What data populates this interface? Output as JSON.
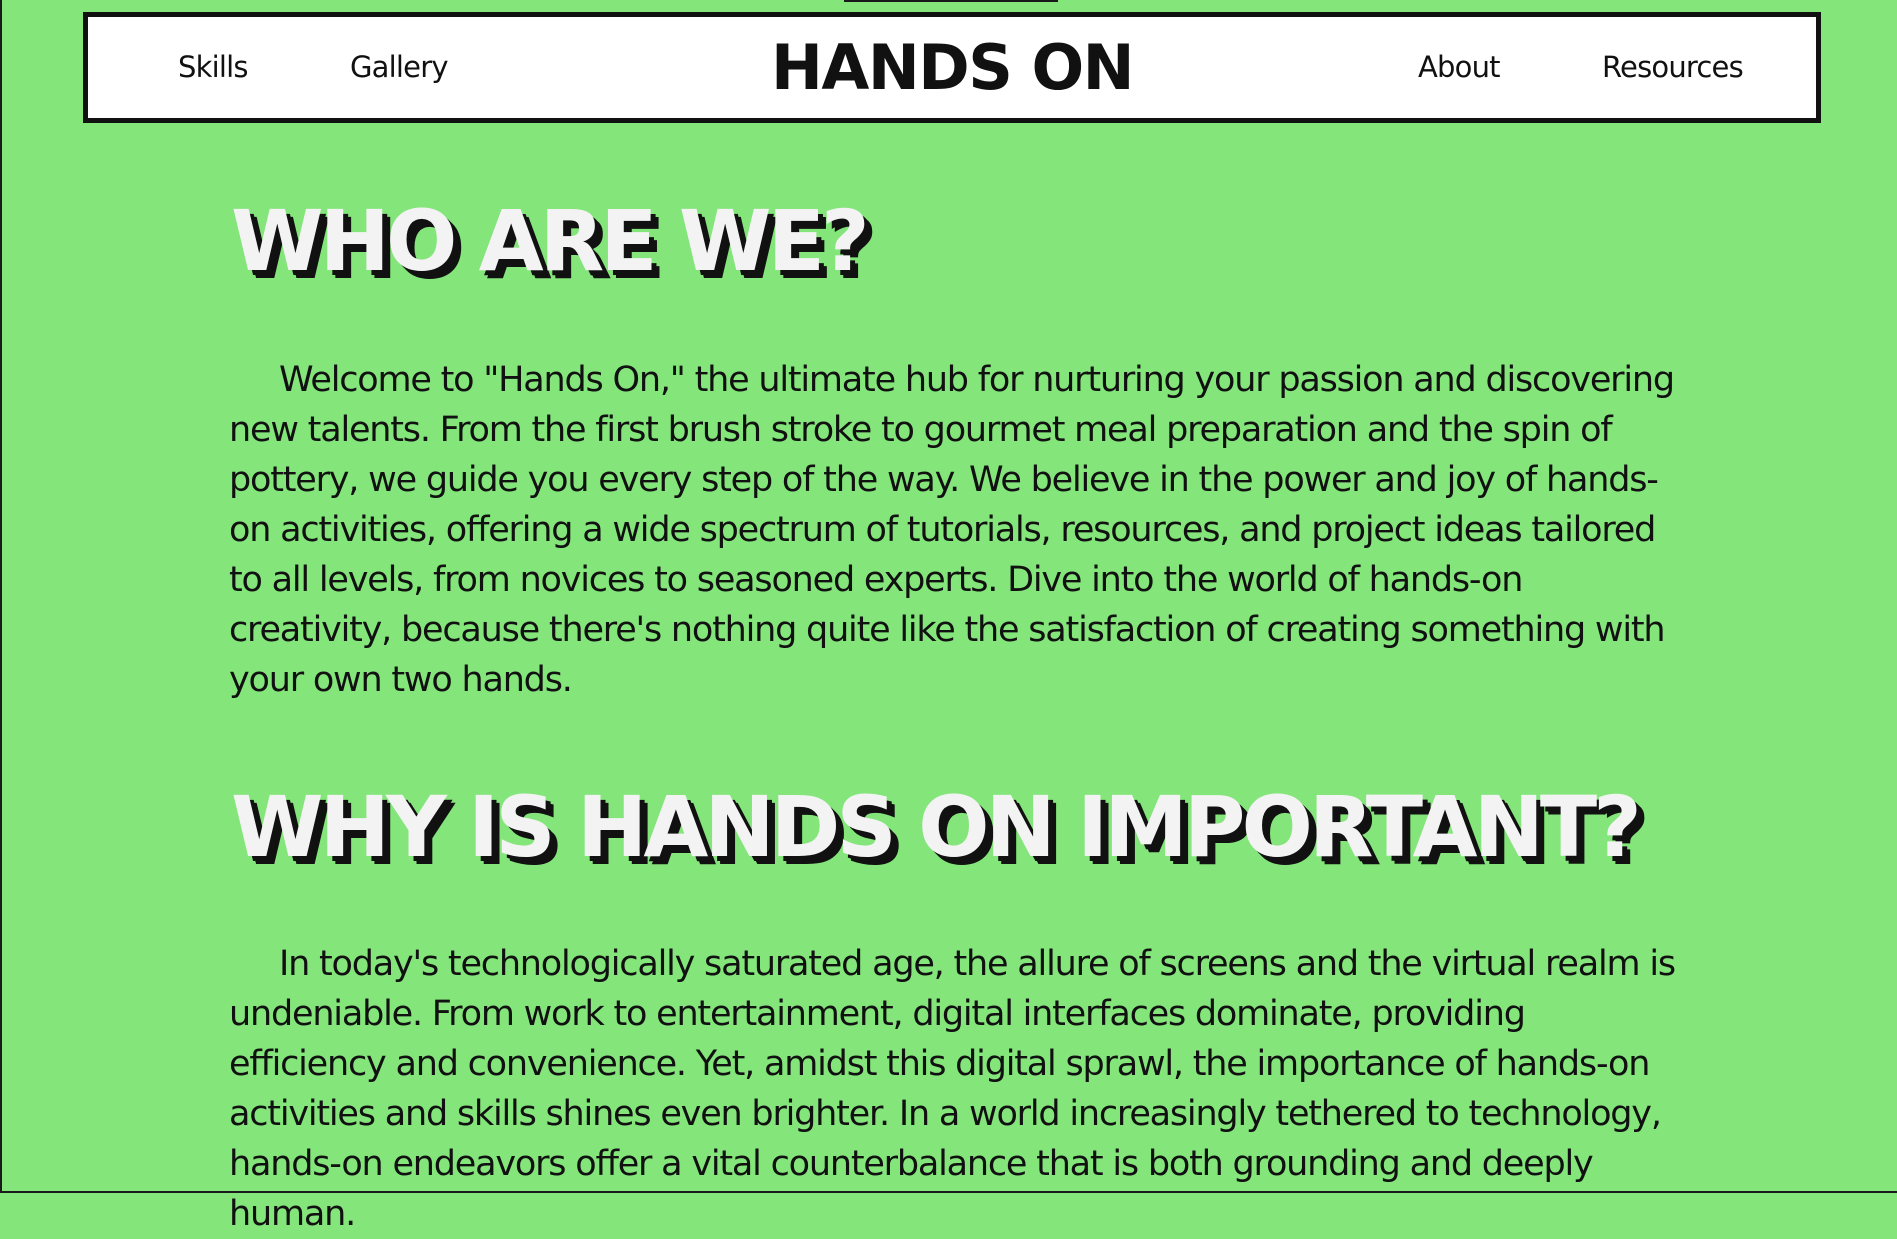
{
  "nav": {
    "left_links": [
      "Skills",
      "Gallery"
    ],
    "brand": "HANDS ON",
    "right_links": [
      "About",
      "Resources"
    ]
  },
  "sections": [
    {
      "heading": "WHO ARE WE?",
      "body": "Welcome to \"Hands On,\" the ultimate hub for nurturing your passion and discovering new talents. From the first brush stroke to gourmet meal preparation and the spin of pottery, we guide you every step of the way. We believe in the power and joy of hands-on activities, offering a wide spectrum of tutorials, resources, and project ideas tailored to all levels, from novices to seasoned experts. Dive into the world of hands-on creativity, because there's nothing quite like the satisfaction of creating something with your own two hands."
    },
    {
      "heading": "WHY IS HANDS ON IMPORTANT?",
      "body": "In today's technologically saturated age, the allure of screens and the virtual realm is undeniable. From work to entertainment, digital interfaces dominate, providing efficiency and convenience. Yet, amidst this digital sprawl, the importance of hands-on activities and skills shines even brighter. In a world increasingly tethered to technology, hands-on endeavors offer a vital counterbalance that is both grounding and deeply human."
    }
  ],
  "colors": {
    "background": "#84e57b",
    "navbar": "#ffffff",
    "text": "#111111",
    "heading_fill": "#f3f3f3",
    "heading_shadow": "#111111"
  }
}
